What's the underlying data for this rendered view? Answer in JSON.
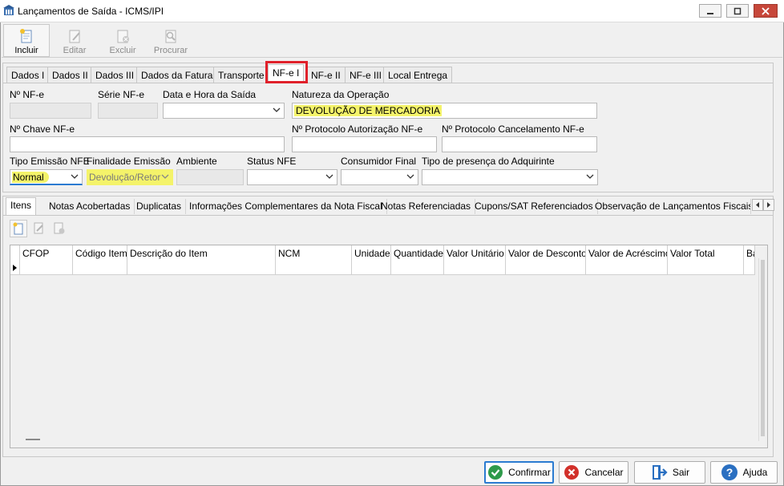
{
  "window": {
    "title": "Lançamentos de Saída - ICMS/IPI"
  },
  "toolbar": {
    "incluir": "Incluir",
    "editar": "Editar",
    "excluir": "Excluir",
    "procurar": "Procurar"
  },
  "tabs": [
    "Dados I",
    "Dados II",
    "Dados III",
    "Dados da Fatura",
    "Transporte",
    "NF-e I",
    "NF-e II",
    "NF-e III",
    "Local Entrega"
  ],
  "form": {
    "nf_label": "Nº NF-e",
    "serie_label": "Série NF-e",
    "data_label": "Data e Hora da Saída",
    "natureza_label": "Natureza da Operação",
    "natureza_value": "DEVOLUÇÃO DE MERCADORIA",
    "chave_label": "Nº Chave NF-e",
    "protocolo_aut_label": "Nº Protocolo Autorização NF-e",
    "protocolo_canc_label": "Nº Protocolo Cancelamento NF-e",
    "tipo_emissao_label": "Tipo Emissão NFE",
    "tipo_emissao_value": "Normal",
    "finalidade_label": "Finalidade Emissão",
    "finalidade_value": "Devolução/Retor",
    "ambiente_label": "Ambiente",
    "status_label": "Status NFE",
    "consumidor_label": "Consumidor Final",
    "presenca_label": "Tipo de presença do Adquirinte"
  },
  "bottom_tabs": [
    "Itens",
    "Notas Acobertadas",
    "Duplicatas",
    "Informações Complementares da Nota Fiscal",
    "Notas Referenciadas",
    "Cupons/SAT Referenciados",
    "Observação de Lançamentos Fiscais (C"
  ],
  "grid": {
    "columns": [
      "CFOP",
      "Código Item",
      "Descrição do Item",
      "NCM",
      "Unidade",
      "Quantidade",
      "Valor Unitário",
      "Valor de Desconto",
      "Valor de Acréscimo",
      "Valor Total",
      "Ba"
    ]
  },
  "footer": {
    "confirmar": "Confirmar",
    "cancelar": "Cancelar",
    "sair": "Sair",
    "ajuda": "Ajuda"
  },
  "colors": {
    "highlight": "#f4f36a",
    "tab_highlight_border": "#e0212b",
    "confirm_icon": "#2e9a4a",
    "cancel_icon": "#d2302a",
    "help_icon": "#2a6fc1"
  }
}
